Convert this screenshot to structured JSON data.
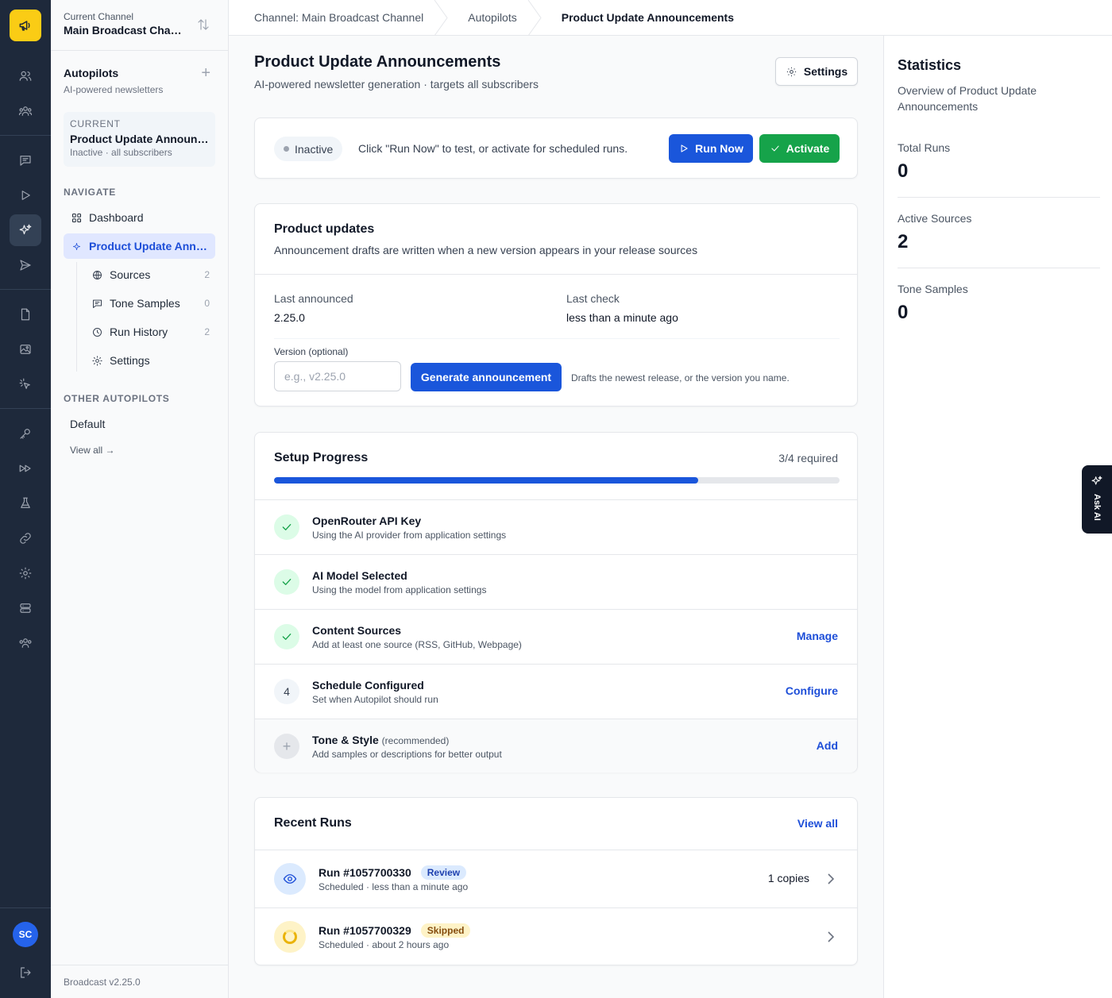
{
  "rail": {
    "avatar_initials": "SC",
    "icons": [
      "megaphone-icon",
      "users-icon",
      "team-icon",
      "message-icon",
      "play-icon",
      "sparkles-icon",
      "send-icon",
      "file-icon",
      "image-icon",
      "cursor-click-icon",
      "key-icon",
      "fast-forward-icon",
      "flask-icon",
      "link-icon",
      "gear-icon",
      "server-icon",
      "group-icon",
      "logout-icon"
    ]
  },
  "sidebar": {
    "channel_label": "Current Channel",
    "channel_name": "Main Broadcast Channel",
    "section_title": "Autopilots",
    "section_subtitle": "AI-powered newsletters",
    "current_label": "CURRENT",
    "current_title": "Product Update Announcements",
    "current_subtitle": "Inactive · all subscribers",
    "navigate_label": "NAVIGATE",
    "nav": {
      "dashboard": "Dashboard",
      "autopilot": "Product Update Announcements"
    },
    "sub": [
      {
        "label": "Sources",
        "count": "2"
      },
      {
        "label": "Tone Samples",
        "count": "0"
      },
      {
        "label": "Run History",
        "count": "2"
      },
      {
        "label": "Settings",
        "count": ""
      }
    ],
    "other_label": "OTHER AUTOPILOTS",
    "other_default": "Default",
    "view_all": "View all →",
    "version": "Broadcast v2.25.0"
  },
  "breadcrumb": [
    "Channel: Main Broadcast Channel",
    "Autopilots",
    "Product Update Announcements"
  ],
  "page": {
    "title": "Product Update Announcements",
    "subtitle": "AI-powered newsletter generation · targets all subscribers",
    "settings_label": "Settings"
  },
  "status": {
    "pill": "Inactive",
    "message": "Click \"Run Now\" to test, or activate for scheduled runs.",
    "run_now": "Run Now",
    "activate": "Activate"
  },
  "product_updates": {
    "title": "Product updates",
    "description": "Announcement drafts are written when a new version appears in your release sources",
    "last_announced_label": "Last announced",
    "last_announced_value": "2.25.0",
    "last_check_label": "Last check",
    "last_check_value": "less than a minute ago",
    "version_label": "Version (optional)",
    "version_placeholder": "e.g., v2.25.0",
    "generate_label": "Generate announcement",
    "hint": "Drafts the newest release, or the version you name."
  },
  "setup": {
    "title": "Setup Progress",
    "required": "3/4 required",
    "progress": 0.75,
    "steps": [
      {
        "title": "OpenRouter API Key",
        "desc": "Using the AI provider from application settings",
        "action": ""
      },
      {
        "title": "AI Model Selected",
        "desc": "Using the model from application settings",
        "action": ""
      },
      {
        "title": "Content Sources",
        "desc": "Add at least one source (RSS, GitHub, Webpage)",
        "action": "Manage"
      },
      {
        "title": "Schedule Configured",
        "desc": "Set when Autopilot should run",
        "action": "Configure",
        "number": "4"
      },
      {
        "title": "Tone & Style",
        "recommended": "(recommended)",
        "desc": "Add samples or descriptions for better output",
        "action": "Add",
        "icon": "+"
      }
    ]
  },
  "recent_runs": {
    "title": "Recent Runs",
    "view_all": "View all",
    "runs": [
      {
        "title": "Run #1057700330",
        "badge": "Review",
        "desc": "Scheduled · less than a minute ago",
        "copies": "1 copies"
      },
      {
        "title": "Run #1057700329",
        "badge": "Skipped",
        "desc": "Scheduled · about 2 hours ago",
        "copies": ""
      }
    ]
  },
  "stats": {
    "title": "Statistics",
    "description": "Overview of Product Update Announcements",
    "items": [
      {
        "label": "Total Runs",
        "value": "0"
      },
      {
        "label": "Active Sources",
        "value": "2"
      },
      {
        "label": "Tone Samples",
        "value": "0"
      }
    ]
  },
  "ask_ai": "Ask AI"
}
